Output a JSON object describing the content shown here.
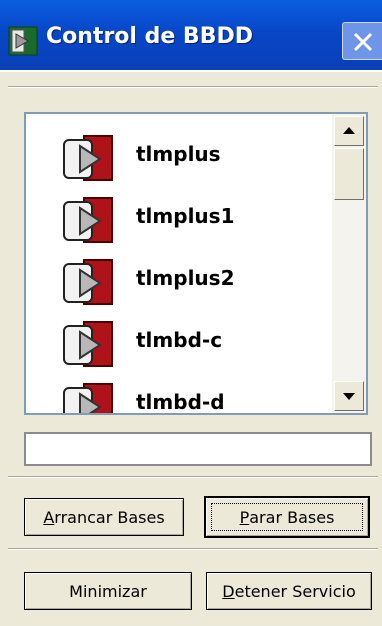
{
  "window": {
    "title": "Control de BBDD",
    "icon": "db-control-app-icon"
  },
  "databases": [
    {
      "name": "tlmplus",
      "icon": "database-service-icon"
    },
    {
      "name": "tlmplus1",
      "icon": "database-service-icon"
    },
    {
      "name": "tlmplus2",
      "icon": "database-service-icon"
    },
    {
      "name": "tlmbd-c",
      "icon": "database-service-icon"
    },
    {
      "name": "tlmbd-d",
      "icon": "database-service-icon"
    }
  ],
  "status_field": {
    "value": ""
  },
  "buttons": {
    "start": {
      "accel": "A",
      "rest": "rrancar Bases"
    },
    "stop": {
      "accel": "P",
      "rest": "arar Bases"
    },
    "minimize": {
      "label": "Minimizar"
    },
    "stop_service": {
      "accel": "D",
      "rest": "etener Servicio"
    }
  },
  "colors": {
    "titlebar": "#0a4fd6",
    "window_bg": "#ece9d8",
    "icon_red": "#b0121a"
  }
}
